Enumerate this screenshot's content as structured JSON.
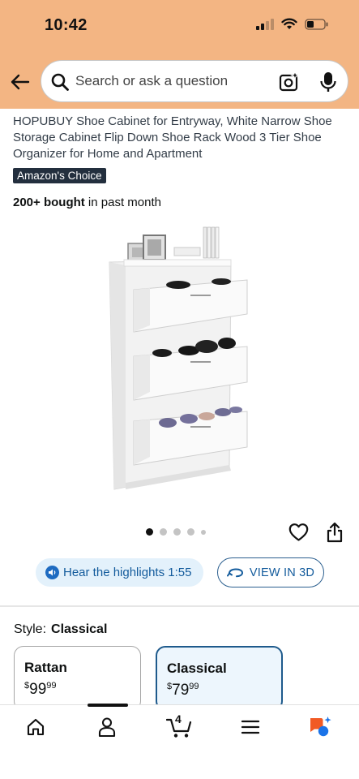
{
  "status_bar": {
    "time": "10:42"
  },
  "search": {
    "placeholder": "Search or ask a question"
  },
  "product": {
    "title": "HOPUBUY Shoe Cabinet for Entryway, White Narrow Shoe Storage Cabinet Flip Down Shoe Rack Wood 3 Tier Shoe Organizer for Home and Apartment",
    "badge": "Amazon's Choice",
    "bought_count": "200+ bought",
    "bought_suffix": " in past month"
  },
  "carousel": {
    "total_images": 5,
    "active_index": 0
  },
  "actions": {
    "highlights_label": "Hear the highlights 1:55",
    "view_3d_label": "VIEW IN 3D"
  },
  "style": {
    "label": "Style:",
    "selected": "Classical",
    "options": [
      {
        "name": "Rattan",
        "currency": "$",
        "dollars": "99",
        "cents": "99"
      },
      {
        "name": "Classical",
        "currency": "$",
        "dollars": "79",
        "cents": "99"
      }
    ]
  },
  "tabbar": {
    "cart_count": "4",
    "active_tab": "account"
  },
  "colors": {
    "header_bg": "#f3b583",
    "badge_bg": "#232f3e",
    "link_blue": "#135b9c",
    "selected_border": "#1e5a8c"
  },
  "icons": [
    "back-arrow-icon",
    "search-icon",
    "camera-icon",
    "mic-icon",
    "heart-icon",
    "share-icon",
    "play-audio-icon",
    "rotate-3d-icon",
    "home-icon",
    "account-icon",
    "cart-icon",
    "menu-icon",
    "ai-assistant-icon"
  ]
}
